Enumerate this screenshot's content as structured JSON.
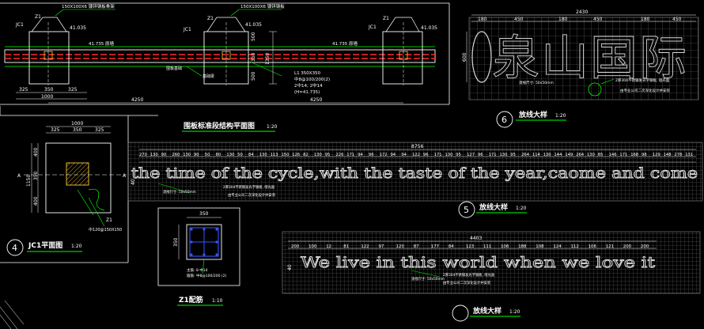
{
  "colors": {
    "background": "#000000",
    "line_white": "#ffffff",
    "line_green": "#00ff00",
    "grid": "#7a7a7a",
    "beam_red": "#ff2a2a",
    "rebar_blue": "#3355ff",
    "dim_yellow": "#ffff66"
  },
  "elev": {
    "labels": {
      "jc1_a": "JC1",
      "z1_a": "Z1",
      "jc1_b": "JC1",
      "z1_b": "Z1",
      "jc1_c": "JC1",
      "z1_c": "Z1",
      "steel_a": "150X100X6 镀锌钢板骨架",
      "steel_b": "150X100X6 镀锌钢板",
      "lvl_a": "41.035",
      "lvl_b": "41.035",
      "lvl_c": "41.035",
      "top_a": "41.735 原墙",
      "top_b": "41.735 原墙",
      "plate": "围板基础",
      "beam": "基础梁",
      "d1000": "1000",
      "d325a": "325",
      "d325b": "325",
      "d350": "350",
      "d4250a": "4250",
      "d4250b": "4250",
      "v500a": "500",
      "v350": "350",
      "v500b": "500",
      "v1350": "1350",
      "beam_note": [
        "L1 350X350",
        "中8@100/200(2)",
        "2中14; 2中14",
        "(H=41.735)"
      ]
    }
  },
  "titles": {
    "elevation": "围板标准段结构平面图",
    "elevation_scale": "1:20",
    "jc1": "JC1平面图",
    "jc1_scale": "1:20",
    "jc1_num": "4",
    "z1": "Z1配筋",
    "z1_scale": "1:10",
    "detail_a": "放线大样",
    "detail_a_scale": "1:20",
    "detail_a_num": "6",
    "detail_b": "放线大样",
    "detail_b_scale": "1:20",
    "detail_b_num": "5",
    "detail_c": "放线大样",
    "detail_c_scale": "1:20"
  },
  "jc1": {
    "dims_top": [
      "1000",
      "325",
      "350",
      "325"
    ],
    "dims_left": [
      "1150",
      "400",
      "350",
      "400"
    ],
    "label_a": "A",
    "label_a2": "A",
    "z1": "Z1",
    "note": "中120@150X150"
  },
  "z1": {
    "dim_top": "350",
    "dim_left": "350",
    "notes": [
      "主筋: 8 中14",
      "箍筋: 中8@100/200 (2)"
    ]
  },
  "detail_a": {
    "text": "泉山国际",
    "total_dim": "2430",
    "dims": [
      "180",
      "450",
      "180",
      "450",
      "180",
      "450"
    ],
    "side_dim": "600",
    "notes": [
      "2厚304不锈钢发光字钢板, 哑光面",
      "烫线尺寸: 50x50mm",
      "由专业公司二次深化设计并安装"
    ]
  },
  "detail_b": {
    "text": "the time of the cycle,with the taste of the year,caome and come",
    "total_dim": "8756",
    "dims": [
      "270",
      "130",
      "90",
      "260",
      "130",
      "90",
      "50",
      "80",
      "130",
      "50",
      "84",
      "130",
      "113",
      "150",
      "126",
      "82",
      "130",
      "95",
      "226",
      "171",
      "94",
      "96",
      "172",
      "94",
      "94",
      "122",
      "96",
      "171",
      "130",
      "95",
      "127",
      "96",
      "171",
      "130",
      "95",
      "264",
      "114",
      "130",
      "144",
      "149",
      "264",
      "130",
      "85",
      "146",
      "171",
      "168",
      "98",
      "129",
      "148",
      "278",
      "131"
    ],
    "side_dim": "40",
    "notes": [
      "2厚304不锈钢发光字钢板, 哑光面",
      "烫线尺寸: 50x50mm",
      "由专业公司二次深化设计并安装"
    ]
  },
  "detail_c": {
    "text": "We live in this world when we love it",
    "total_dim": "4403",
    "dims": [
      "200",
      "100",
      "12",
      "81",
      "122",
      "97",
      "120",
      "87",
      "177",
      "84",
      "123",
      "111",
      "106",
      "188",
      "108",
      "124",
      "112",
      "106",
      "121",
      "200",
      "200"
    ],
    "side_dim": "40",
    "notes": [
      "2厚304不锈钢发光字钢板, 哑光面",
      "烫线尺寸: 50x50mm",
      "由专业公司二次深化设计并安装"
    ]
  }
}
